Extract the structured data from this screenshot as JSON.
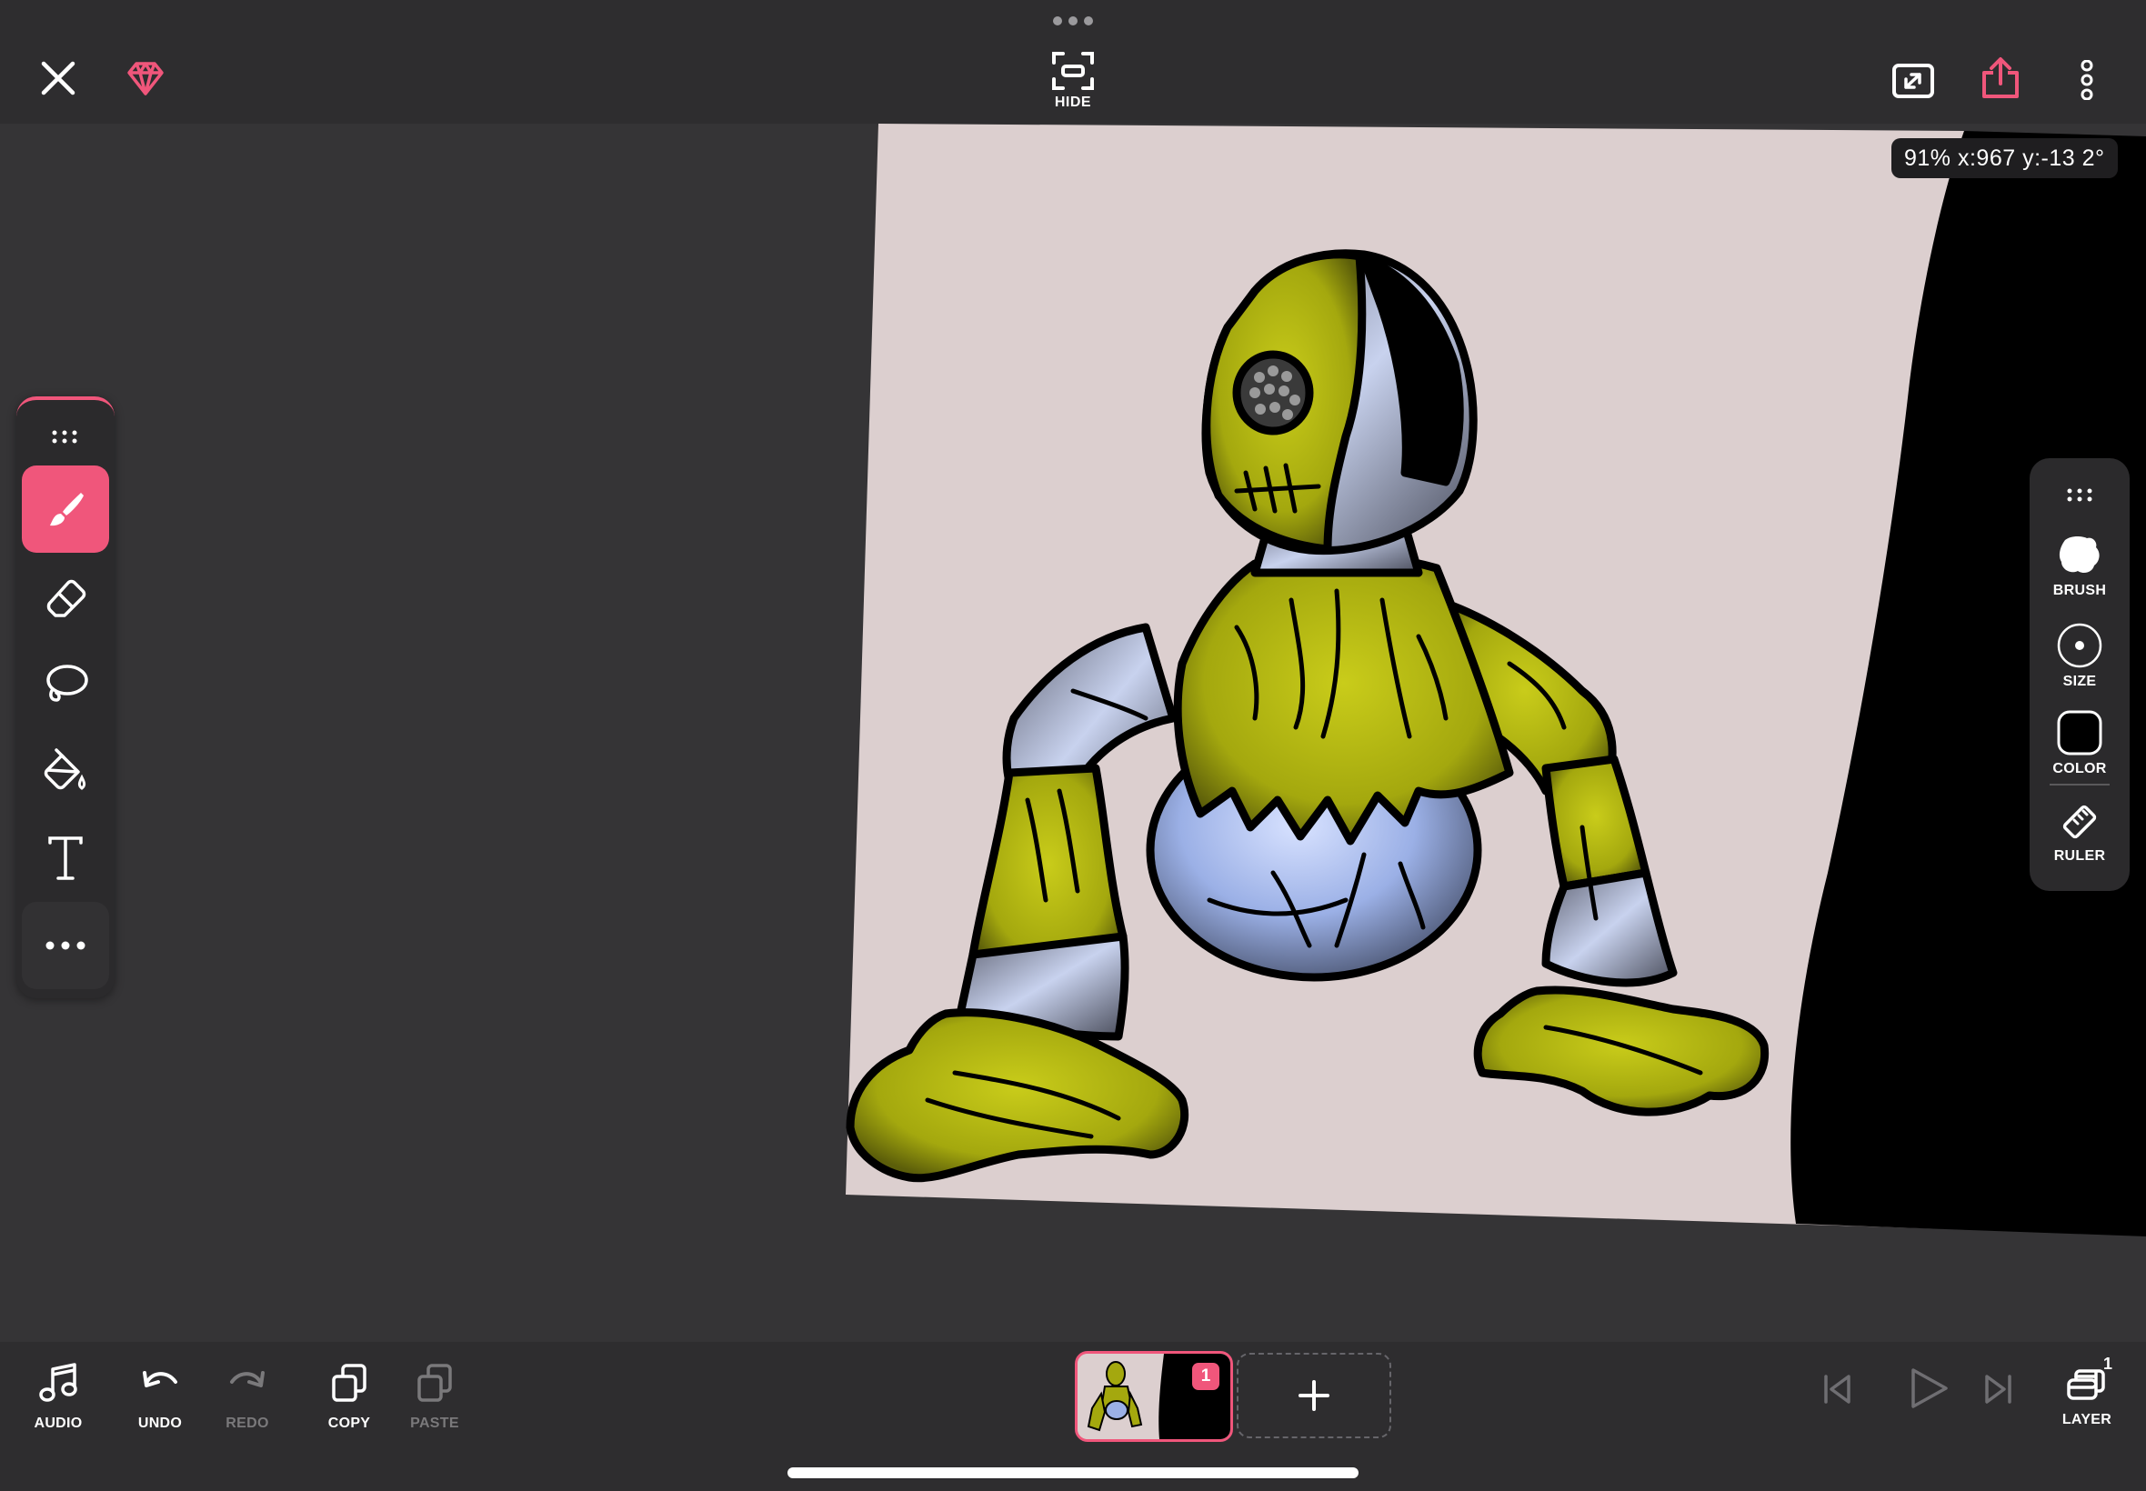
{
  "topbar": {
    "hide_label": "HIDE",
    "icons": [
      "close-icon",
      "premium-gem-icon",
      "hide-ui-icon",
      "fullscreen-icon",
      "share-icon",
      "more-vertical-icon"
    ]
  },
  "canvas": {
    "readout": "91% x:967 y:-13 2°"
  },
  "left_tools": [
    "brush-icon",
    "eraser-icon",
    "lasso-icon",
    "fill-bucket-icon",
    "text-icon",
    "more-horizontal-icon"
  ],
  "right_panel": {
    "brush_label": "BRUSH",
    "size_label": "SIZE",
    "color_label": "COLOR",
    "ruler_label": "RULER",
    "current_color": "#000000"
  },
  "bottombar": {
    "audio_label": "AUDIO",
    "undo_label": "UNDO",
    "redo_label": "REDO",
    "copy_label": "COPY",
    "paste_label": "PASTE",
    "frame_number": "1",
    "layer_label": "LAYER",
    "layer_count": "1"
  },
  "colors": {
    "accent": "#f0567b",
    "bar_background": "#2e2d2f",
    "canvas_background": "#353436",
    "paper": "#dccfcf"
  }
}
